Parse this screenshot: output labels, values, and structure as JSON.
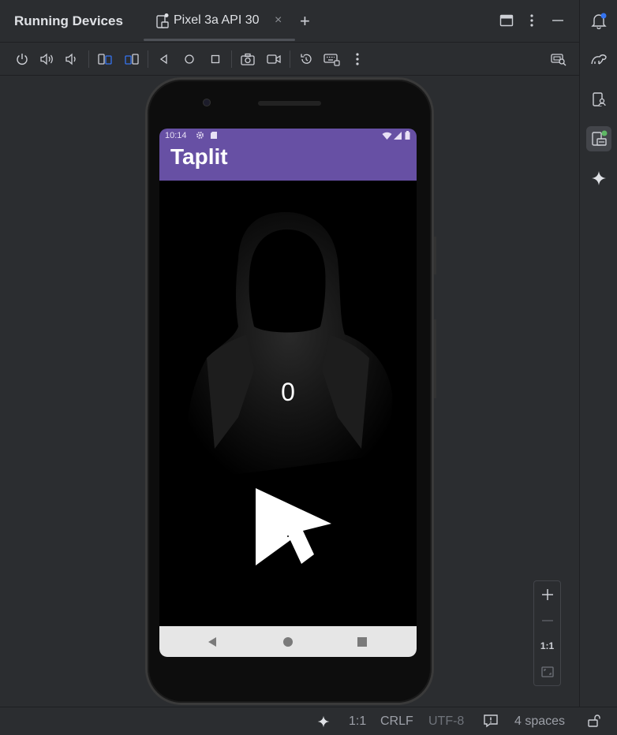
{
  "panel": {
    "title": "Running Devices"
  },
  "device_tab": {
    "label": "Pixel 3a API 30",
    "close": "×"
  },
  "add_tab": "+",
  "phone": {
    "status_time": "10:14",
    "app_title": "Taplit",
    "counter": "0"
  },
  "zoom": {
    "one_to_one": "1:1"
  },
  "statusline": {
    "ratio": "1:1",
    "line_endings": "CRLF",
    "encoding": "UTF-8",
    "indent": "4 spaces"
  },
  "colors": {
    "app_bar": "#6750a4",
    "background": "#2b2d30",
    "accent_dot": "#3574f0",
    "notification_dot": "#5fb865"
  },
  "icons": {
    "toolbar": [
      "power-icon",
      "volume-up-icon",
      "volume-down-icon",
      "rotate-left-icon",
      "rotate-right-icon",
      "back-icon",
      "home-icon",
      "overview-icon",
      "screenshot-icon",
      "screen-record-icon",
      "restore-icon",
      "keyboard-icon",
      "more-icon",
      "device-mirror-icon"
    ],
    "stripe": [
      "notifications-icon",
      "gradle-icon",
      "device-manager-icon",
      "running-devices-icon",
      "gemini-icon"
    ]
  }
}
